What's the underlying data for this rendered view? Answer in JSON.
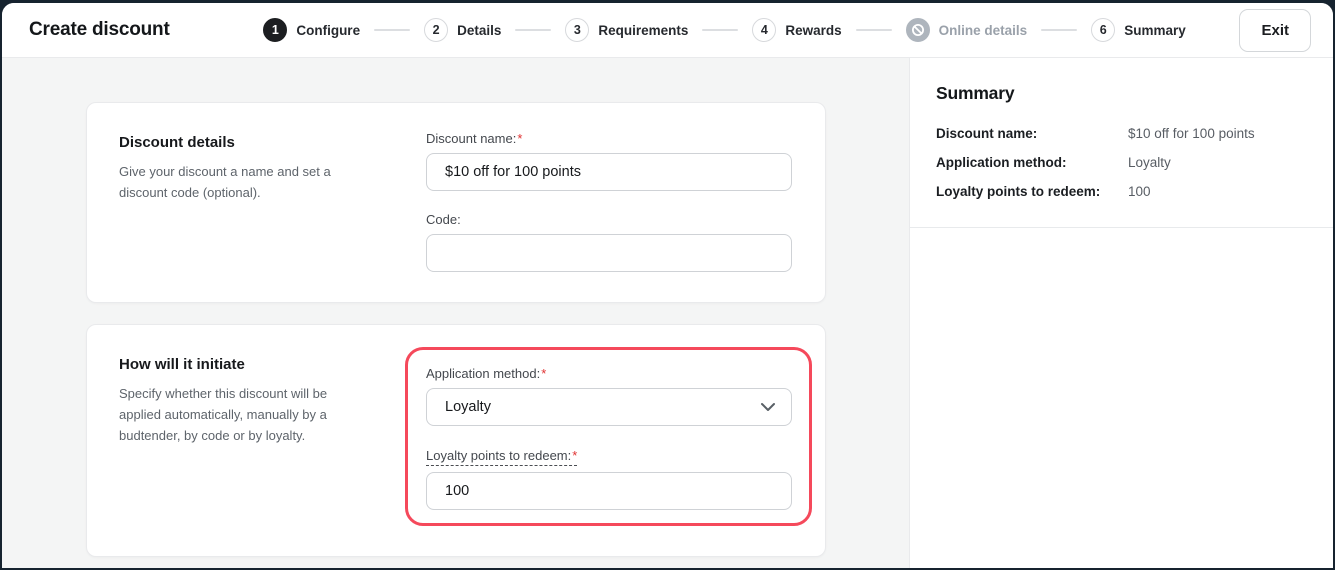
{
  "header": {
    "title": "Create discount",
    "exit_label": "Exit",
    "steps": [
      {
        "number": "1",
        "label": "Configure",
        "state": "active"
      },
      {
        "number": "2",
        "label": "Details",
        "state": "upcoming"
      },
      {
        "number": "3",
        "label": "Requirements",
        "state": "upcoming"
      },
      {
        "number": "4",
        "label": "Rewards",
        "state": "upcoming"
      },
      {
        "number": "",
        "label": "Online details",
        "state": "disabled",
        "icon": "prohibited-icon"
      },
      {
        "number": "6",
        "label": "Summary",
        "state": "upcoming"
      }
    ]
  },
  "required_marker": "*",
  "cards": [
    {
      "title": "Discount details",
      "description": "Give your discount a name and set a discount code (optional).",
      "fields": [
        {
          "label": "Discount name:",
          "required": true,
          "value": "$10 off for 100 points",
          "type": "text"
        },
        {
          "label": "Code:",
          "required": false,
          "value": "",
          "type": "text"
        }
      ]
    },
    {
      "title": "How will it initiate",
      "description": "Specify whether this discount will be applied automatically, manually by a budtender, by code or by loyalty.",
      "highlighted": true,
      "fields": [
        {
          "label": "Application method:",
          "required": true,
          "value": "Loyalty",
          "type": "select",
          "icon": "chevron-down-icon"
        },
        {
          "label": "Loyalty points to redeem:",
          "required": true,
          "value": "100",
          "type": "text",
          "tooltip_underline": true
        }
      ]
    }
  ],
  "summary": {
    "title": "Summary",
    "rows": [
      {
        "label": "Discount name:",
        "value": "$10 off for 100 points"
      },
      {
        "label": "Application method:",
        "value": "Loyalty"
      },
      {
        "label": "Loyalty points to redeem:",
        "value": "100"
      }
    ]
  },
  "colors": {
    "highlight_ring": "#f5495b",
    "required_red": "#e03131",
    "active_step_bg": "#1c1e21",
    "disabled_step_bg": "#aeb5bd",
    "frame_bg": "#16232f",
    "main_bg": "#f4f5f5"
  }
}
